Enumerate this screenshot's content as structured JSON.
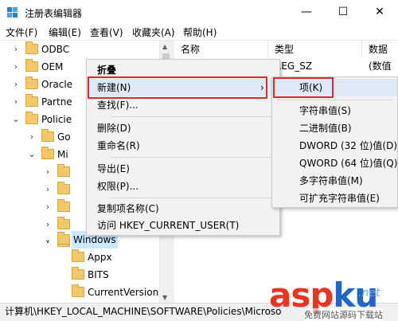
{
  "window": {
    "title": "注册表编辑器",
    "minimize_glyph": "—",
    "maximize_glyph": "☐",
    "close_glyph": "✕"
  },
  "menubar": [
    "文件(F)",
    "编辑(E)",
    "查看(V)",
    "收藏夹(A)",
    "帮助(H)"
  ],
  "tree": {
    "items": [
      {
        "label": "ODBC",
        "expander": "›"
      },
      {
        "label": "OEM",
        "expander": "›"
      },
      {
        "label": "Oracle",
        "expander": "›"
      },
      {
        "label": "Partne",
        "expander": "›"
      },
      {
        "label": "Policie",
        "expander": "⌄"
      },
      {
        "label": "Go",
        "expander": "›"
      },
      {
        "label": "Mi",
        "expander": "⌄"
      },
      {
        "label": "",
        "expander": "›"
      },
      {
        "label": "",
        "expander": "›"
      },
      {
        "label": "",
        "expander": "›"
      },
      {
        "label": "",
        "expander": "›"
      },
      {
        "label": "",
        "expander": "›"
      },
      {
        "label": "",
        "expander": "›"
      },
      {
        "label": "Windows",
        "expander": "⌄"
      },
      {
        "label": "Appx",
        "expander": ""
      },
      {
        "label": "BITS",
        "expander": ""
      },
      {
        "label": "CurrentVersion",
        "expander": ""
      }
    ]
  },
  "list": {
    "columns": [
      "名称",
      "类型",
      "数据"
    ],
    "rows": [
      {
        "name": "",
        "type": "REG_SZ",
        "data": "(数值未"
      }
    ]
  },
  "status_path": "计算机\\HKEY_LOCAL_MACHINE\\SOFTWARE\\Policies\\Microso",
  "context_menu": {
    "items": [
      {
        "label": "折叠",
        "bold": true
      },
      {
        "label": "新建(N)",
        "arrow": "›"
      },
      {
        "label": "查找(F)..."
      },
      {
        "label": "删除(D)"
      },
      {
        "label": "重命名(R)"
      },
      {
        "label": "导出(E)"
      },
      {
        "label": "权限(P)..."
      },
      {
        "label": "复制项名称(C)"
      },
      {
        "label": "访问 HKEY_CURRENT_USER(T)"
      }
    ]
  },
  "submenu": {
    "items": [
      "项(K)",
      "字符串值(S)",
      "二进制值(B)",
      "DWORD (32 位)值(D)",
      "QWORD (64 位)值(Q)",
      "多字符串值(M)",
      "可扩充字符串值(E)"
    ]
  },
  "watermark": {
    "brand_a": "asp",
    "brand_b": "ku",
    "net": ".net",
    "subtitle": "免费网站源码下载站"
  },
  "colors": {
    "highlight_box": "#e02a2a",
    "selection": "#cce8ff",
    "folder": "#f1c86a"
  }
}
